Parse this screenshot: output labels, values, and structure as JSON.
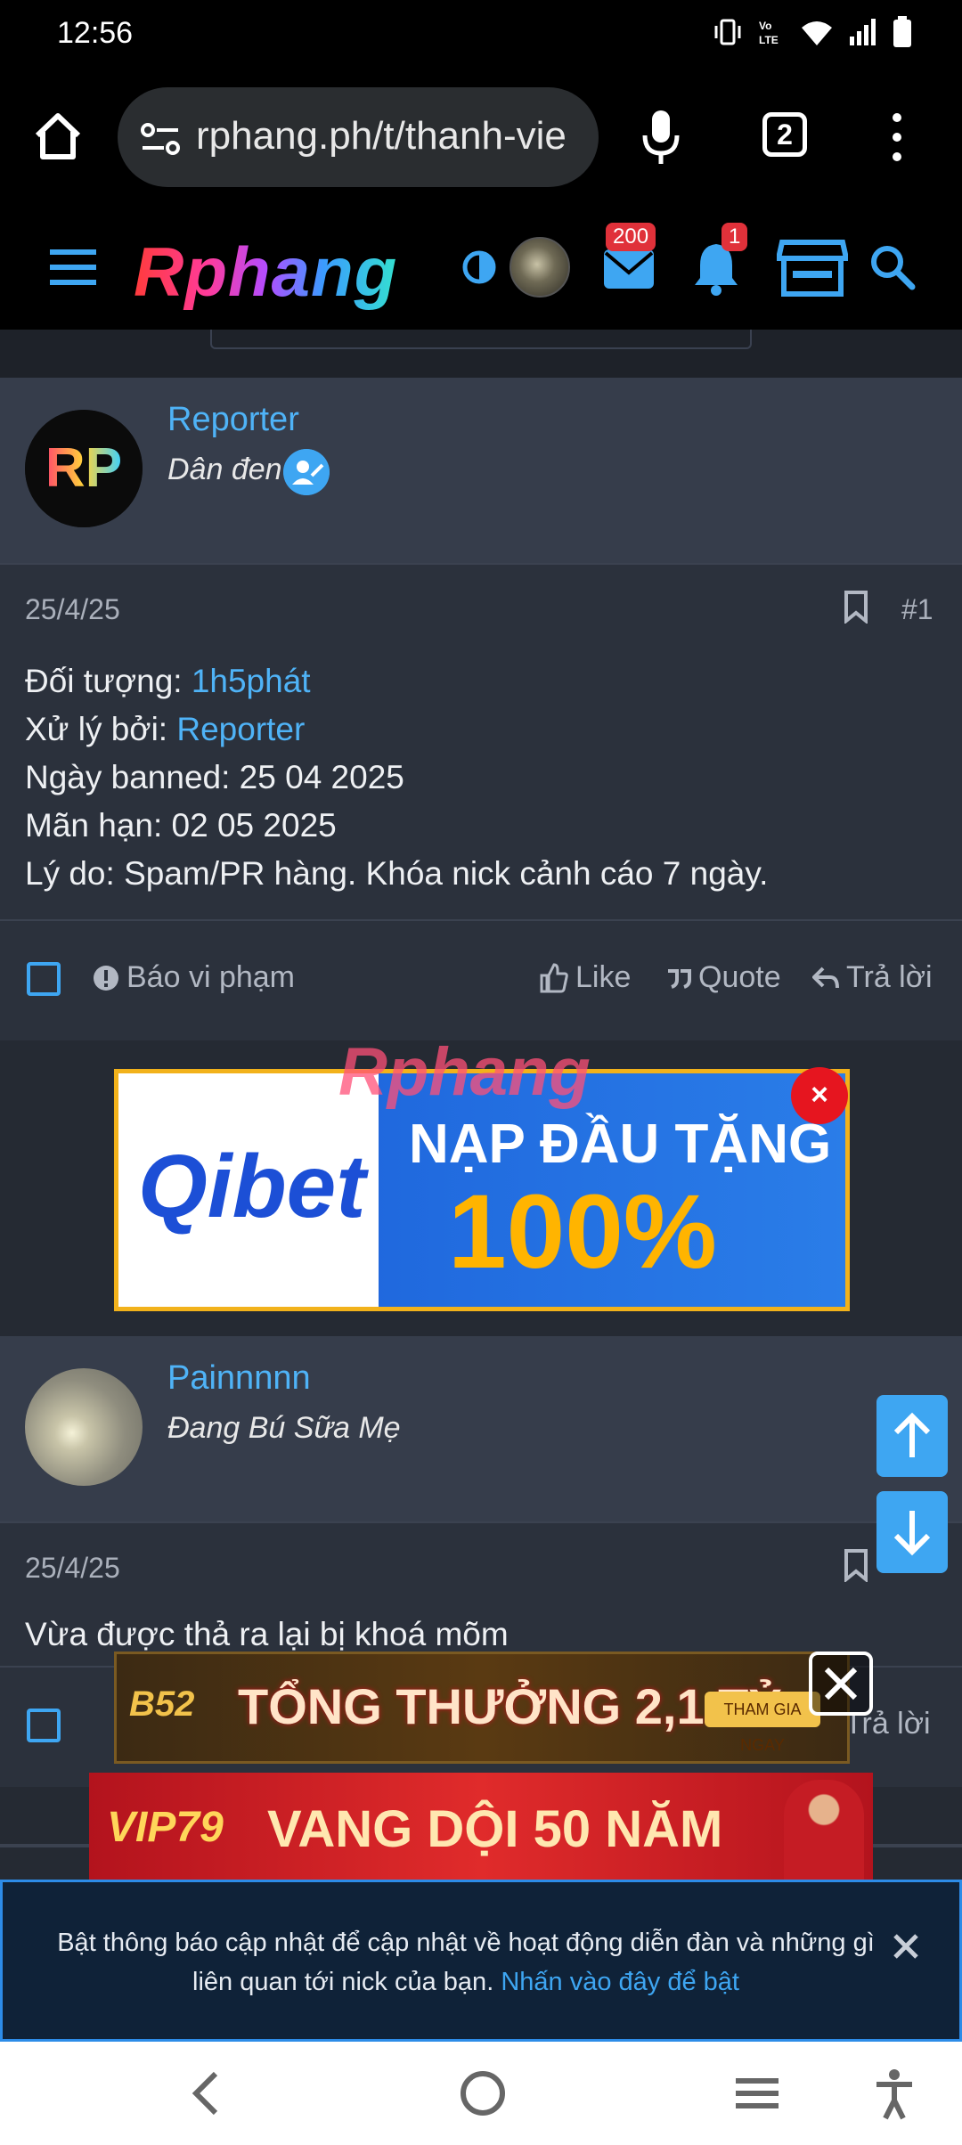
{
  "status": {
    "time": "12:56"
  },
  "browser": {
    "url": "rphang.ph/t/thanh-vie",
    "tab_count": "2"
  },
  "site": {
    "logo": "Rphang",
    "badges": {
      "inbox": "200",
      "alerts": "1"
    }
  },
  "posts": [
    {
      "username": "Reporter",
      "user_title": "Dân đen",
      "date": "25/4/25",
      "number": "#1",
      "lines": [
        {
          "label": "Đối tượng: ",
          "link": "1h5phát"
        },
        {
          "label": "Xử lý bởi: ",
          "link": "Reporter"
        },
        {
          "text": "Ngày banned: 25 04 2025"
        },
        {
          "text": "Mãn hạn: 02 05 2025"
        },
        {
          "text": "Lý do: Spam/PR hàng. Khóa nick cảnh cáo 7 ngày."
        }
      ],
      "actions": {
        "report": "Báo vi phạm",
        "like": "Like",
        "quote": "Quote",
        "reply": "Trả lời"
      }
    },
    {
      "username": "Painnnnn",
      "user_title": "Đang Bú Sữa Mẹ",
      "date": "25/4/25",
      "content": "Vừa được thả ra lại bị khoá mõm",
      "actions": {
        "reply": "Trả lời"
      }
    }
  ],
  "ads": {
    "qibet": {
      "brand": "Qibet",
      "line1": "NẠP ĐẦU TẶNG",
      "line2": "100%",
      "watermark": "Rphang",
      "close": "×"
    },
    "b52": {
      "brand": "B52",
      "text": "TỔNG THƯỞNG 2,1 TỶ",
      "cta": "THAM GIA NGAY"
    },
    "vip79": {
      "brand": "VIP79",
      "text": "VANG DỘI 50 NĂM"
    }
  },
  "notice": {
    "text": "Bật thông báo cập nhật để cập nhật về hoạt động diễn đàn và những gì liên quan tới nick của bạn. ",
    "link": "Nhấn vào đây để bật"
  },
  "colors": {
    "accent": "#3ea6f2",
    "post_bg": "#2b313c",
    "header_bg": "#363d4b",
    "badge": "#e0313a"
  }
}
